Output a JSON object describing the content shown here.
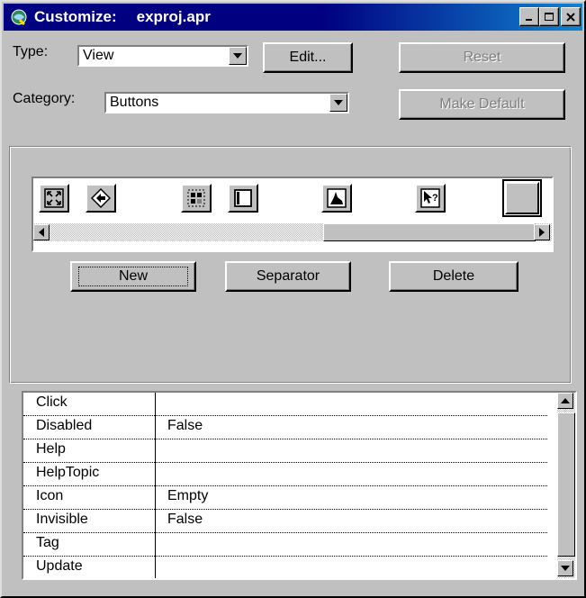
{
  "window": {
    "title_prefix": "Customize:",
    "title_project": "exproj.apr",
    "icon": "customize-app-icon",
    "controls": [
      "minimize-icon",
      "maximize-icon",
      "close-icon"
    ]
  },
  "form": {
    "type_label": "Type:",
    "type_value": "View",
    "category_label": "Category:",
    "category_value": "Buttons",
    "edit_label": "Edit...",
    "reset_label": "Reset",
    "make_default_label": "Make Default"
  },
  "toolbar": {
    "icons": [
      "zoom-extent-icon",
      "zoom-previous-icon",
      "select-features-icon",
      "legend-icon",
      "histogram-icon",
      "help-pointer-icon",
      "empty-button-icon"
    ]
  },
  "actions": {
    "new_label": "New",
    "separator_label": "Separator",
    "delete_label": "Delete"
  },
  "properties": [
    {
      "name": "Click",
      "value": ""
    },
    {
      "name": "Disabled",
      "value": "False"
    },
    {
      "name": "Help",
      "value": ""
    },
    {
      "name": "HelpTopic",
      "value": ""
    },
    {
      "name": "Icon",
      "value": "Empty"
    },
    {
      "name": "Invisible",
      "value": "False"
    },
    {
      "name": "Tag",
      "value": ""
    },
    {
      "name": "Update",
      "value": ""
    }
  ],
  "colors": {
    "title_bar": "#000080",
    "face": "#c0c0c0",
    "disabled_text": "#808080"
  }
}
